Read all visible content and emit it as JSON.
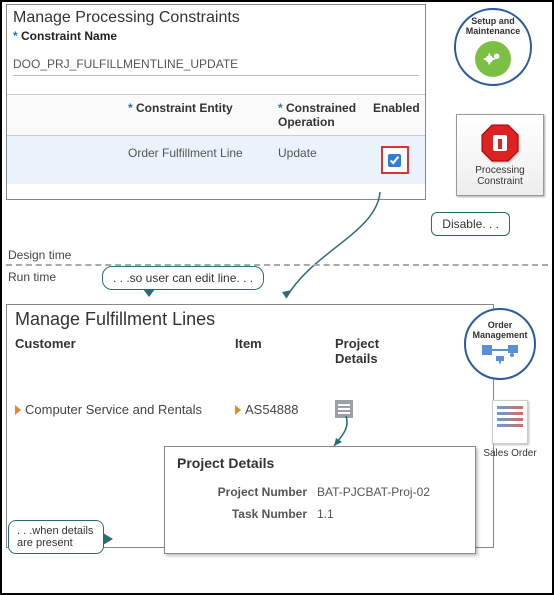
{
  "top": {
    "title": "Manage Processing Constraints",
    "name_label": "Constraint Name",
    "name_value": "DOO_PRJ_FULFILLMENTLINE_UPDATE",
    "cols": {
      "entity": "Constraint Entity",
      "operation": "Constrained Operation",
      "enabled": "Enabled"
    },
    "row": {
      "entity": "Order Fulfillment Line",
      "operation": "Update",
      "enabled": true
    }
  },
  "badges": {
    "setup": "Setup and Maintenance",
    "proc_constraint": "Processing Constraint",
    "order_mgmt": "Order Management",
    "sales_order": "Sales Order"
  },
  "callouts": {
    "disable": "Disable. . .",
    "user_edit": ". . .so user can edit line. . .",
    "details_present": ". . .when details are present"
  },
  "phase": {
    "design": "Design time",
    "run": "Run time"
  },
  "bottom": {
    "title": "Manage Fulfillment Lines",
    "cols": {
      "customer": "Customer",
      "item": "Item",
      "project_details": "Project Details"
    },
    "row": {
      "customer": "Computer Service and Rentals",
      "item": "AS54888"
    }
  },
  "popup": {
    "title": "Project Details",
    "project_number_label": "Project Number",
    "project_number_value": "BAT-PJCBAT-Proj-02",
    "task_number_label": "Task Number",
    "task_number_value": "1.1"
  }
}
